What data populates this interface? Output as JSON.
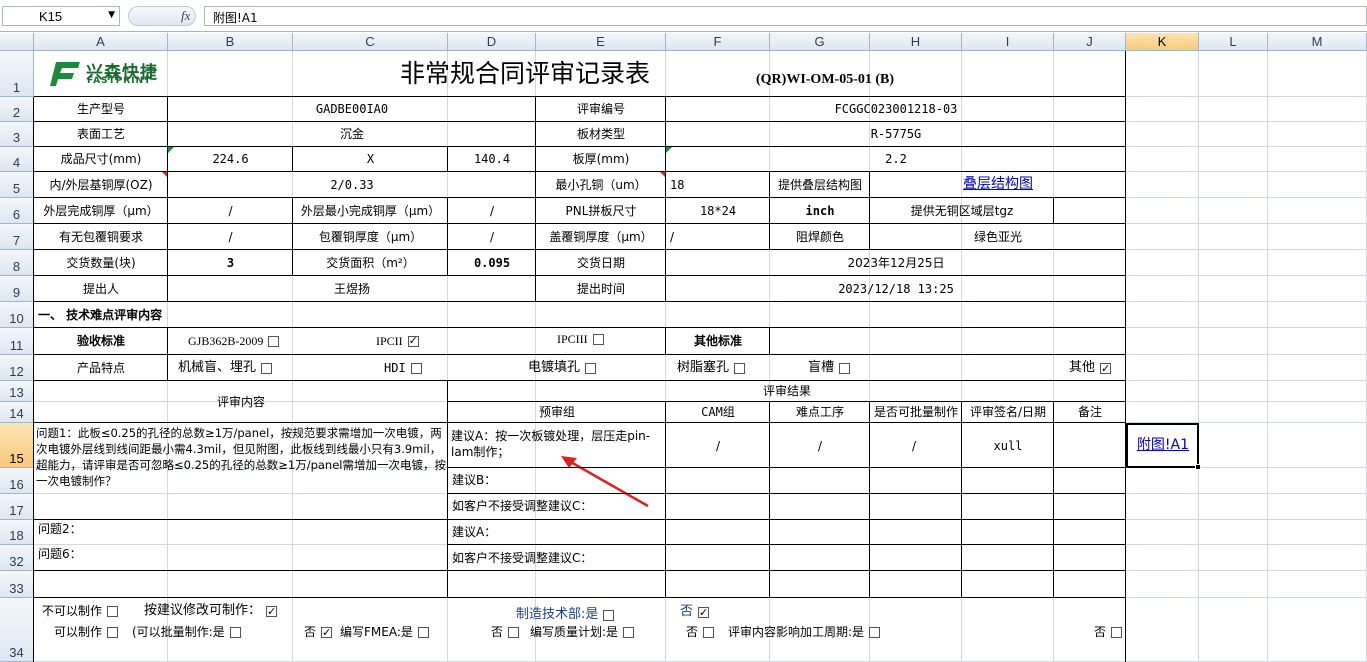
{
  "formula_bar": {
    "name_box": "K15",
    "fx": "fx",
    "formula": "附图!A1"
  },
  "columns": [
    "A",
    "B",
    "C",
    "D",
    "E",
    "F",
    "G",
    "H",
    "I",
    "J",
    "K",
    "L",
    "M"
  ],
  "rows": [
    "1",
    "2",
    "3",
    "4",
    "5",
    "6",
    "7",
    "8",
    "9",
    "10",
    "11",
    "12",
    "13",
    "14",
    "15",
    "16",
    "17",
    "18",
    "32",
    "33",
    "34"
  ],
  "header": {
    "logo_cn": "兴森快捷",
    "logo_en": "FASTPRINT",
    "title": "非常规合同评审记录表",
    "code": "(QR)WI-OM-05-01 (B)"
  },
  "form": {
    "r2": {
      "a": "生产型号",
      "b": "GADBE00IA0",
      "e": "评审编号",
      "f": "FCGGC023001218-03"
    },
    "r3": {
      "a": "表面工艺",
      "b": "沉金",
      "e": "板材类型",
      "f": "R-5775G"
    },
    "r4": {
      "a": "成品尺寸(mm)",
      "b": "224.6",
      "c": "X",
      "d": "140.4",
      "e": "板厚(mm)",
      "f": "2.2"
    },
    "r5": {
      "a": "内/外层基铜厚(OZ)",
      "b": "2/0.33",
      "e": "最小孔铜（um）",
      "f": "18",
      "g": "提供叠层结构图",
      "h": "叠层结构图"
    },
    "r6": {
      "a": "外层完成铜厚（μm）",
      "b": "/",
      "c": "外层最小完成铜厚（μm）",
      "d": "/",
      "e": "PNL拼板尺寸",
      "f": "18*24",
      "g": "inch",
      "h": "提供无铜区域层tgz"
    },
    "r7": {
      "a": "有无包覆铜要求",
      "b": "/",
      "c": "包覆铜厚度（μm）",
      "d": "/",
      "e": "盖覆铜厚度（μm）",
      "f": "/",
      "g": "阻焊颜色",
      "h": "绿色亚光"
    },
    "r8": {
      "a": "交货数量(块)",
      "b": "3",
      "c": "交货面积（m²）",
      "d": "0.095",
      "e": "交货日期",
      "f": "2023年12月25日"
    },
    "r9": {
      "a": "提出人",
      "b": "王煜扬",
      "e": "提出时间",
      "f": "2023/12/18 13:25"
    },
    "r10": {
      "a": "一、 技术难点评审内容"
    },
    "r11": {
      "a": "验收标准",
      "b": "GJB362B-2009",
      "c": "IPCII",
      "e": "IPCIII",
      "f": "其他标准"
    },
    "r12": {
      "a": "产品特点",
      "b": "机械盲、埋孔",
      "c": "HDI",
      "d": "电镀填孔",
      "e": "树脂塞孔",
      "g": "盲槽",
      "j": "其他"
    },
    "r13": {
      "a": "评审内容",
      "d": "评审结果"
    },
    "r14": {
      "d": "预审组",
      "f": "CAM组",
      "g": "难点工序",
      "h": "是否可批量制作",
      "i": "评审签名/日期",
      "j": "备注"
    },
    "r15": {
      "a": "问题1：此板≤0.25的孔径的总数≥1万/panel，按规范要求需增加一次电镀，两次电镀外层线到线间距最小需4.3mil，但见附图，此板线到线最小只有3.9mil，超能力，请评审是否可忽略≤0.25的孔径的总数≥1万/panel需增加一次电镀，按一次电镀制作？",
      "d": "建议A：按一次板镀处理，层压走pin-lam制作；",
      "f": "/",
      "g": "/",
      "h": "/",
      "i": "xull",
      "k": "附图!A1"
    },
    "r16": {
      "d": "建议B："
    },
    "r17": {
      "d": "如客户不接受调整建议C："
    },
    "r18": {
      "a": "问题2：",
      "d": "建议A："
    },
    "r32": {
      "a": "问题6：",
      "d": "如客户不接受调整建议C："
    },
    "footer1": {
      "a": "不可以制作",
      "b": "按建议修改可制作：",
      "e": "制造技术部:是",
      "f": "否"
    },
    "footer2": {
      "a": "可以制作",
      "b": "(可以批量制作:是",
      "c": "否",
      "c2": "编写FMEA:是",
      "d": "否",
      "e": "编写质量计划:是",
      "f": "否",
      "g": "评审内容影响加工周期:是",
      "j": "否"
    }
  },
  "checkboxes": {
    "gjb": false,
    "ipcii": true,
    "ipciii": false,
    "mech": false,
    "hdi": false,
    "fill": false,
    "resin": false,
    "blind": false,
    "other": true,
    "cannot": false,
    "modify": true,
    "mfg_yes": false,
    "mfg_no": true,
    "can": false,
    "batch_yes": false,
    "batch_no": true,
    "fmea_yes": false,
    "fmea_no": false,
    "qp_yes": false,
    "qp_no": false,
    "cycle_yes": false,
    "cycle_no": false
  },
  "colors": {
    "header_bg": "#dde6f1",
    "selected_header": "#f8c978",
    "gridline": "#d0d7e5",
    "arrow": "#e02020",
    "link": "#0000cc"
  }
}
